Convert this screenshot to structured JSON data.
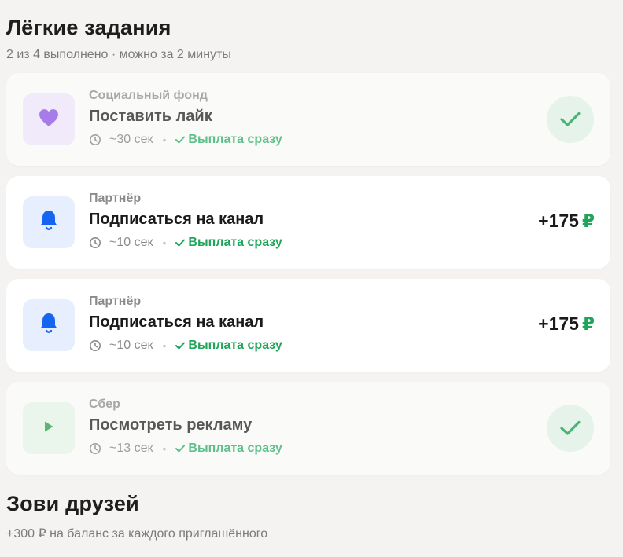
{
  "easy_tasks": {
    "title": "Лёгкие задания",
    "subtitle": "2 из 4 выполнено · можно за 2 минуты",
    "tasks": [
      {
        "source": "Социальный фонд",
        "title": "Поставить лайк",
        "duration": "~30 сек",
        "payout": "Выплата сразу",
        "icon": "heart-icon",
        "status": "done"
      },
      {
        "source": "Партнёр",
        "title": "Подписаться на канал",
        "duration": "~10 сек",
        "payout": "Выплата сразу",
        "icon": "bell-icon",
        "reward_amount": "+175",
        "reward_currency": "₽",
        "status": "available"
      },
      {
        "source": "Партнёр",
        "title": "Подписаться на канал",
        "duration": "~10 сек",
        "payout": "Выплата сразу",
        "icon": "bell-icon",
        "reward_amount": "+175",
        "reward_currency": "₽",
        "status": "available"
      },
      {
        "source": "Сбер",
        "title": "Посмотреть рекламу",
        "duration": "~13 сек",
        "payout": "Выплата сразу",
        "icon": "play-icon",
        "status": "done"
      }
    ]
  },
  "invite_friends": {
    "title": "Зови друзей",
    "subtitle": "+300 ₽ на баланс за каждого приглашённого"
  },
  "colors": {
    "background": "#f4f3f1",
    "accent_green": "#1fa55a",
    "heart_purple": "#a77be8",
    "bell_blue": "#1565f0",
    "play_green": "#57b871"
  }
}
